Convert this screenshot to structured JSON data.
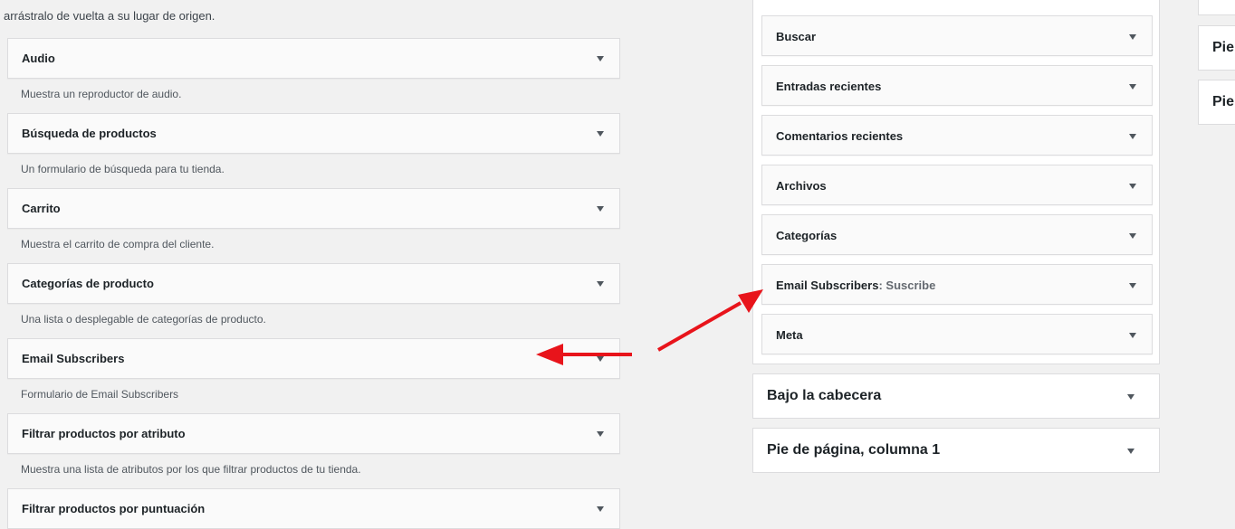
{
  "intro_text": "arrástralo de vuelta a su lugar de origen.",
  "available_widgets": [
    {
      "title": "Audio",
      "description": "Muestra un reproductor de audio."
    },
    {
      "title": "Búsqueda de productos",
      "description": "Un formulario de búsqueda para tu tienda."
    },
    {
      "title": "Carrito",
      "description": "Muestra el carrito de compra del cliente."
    },
    {
      "title": "Categorías de producto",
      "description": "Una lista o desplegable de categorías de producto."
    },
    {
      "title": "Email Subscribers",
      "description": "Formulario de Email Subscribers"
    },
    {
      "title": "Filtrar productos por atributo",
      "description": "Muestra una lista de atributos por los que filtrar productos de tu tienda."
    },
    {
      "title": "Filtrar productos por puntuación",
      "description": ""
    }
  ],
  "sidebar_widgets": [
    {
      "title": "Buscar",
      "subtitle": ""
    },
    {
      "title": "Entradas recientes",
      "subtitle": ""
    },
    {
      "title": "Comentarios recientes",
      "subtitle": ""
    },
    {
      "title": "Archivos",
      "subtitle": ""
    },
    {
      "title": "Categorías",
      "subtitle": ""
    },
    {
      "title": "Email Subscribers",
      "subtitle": ": Suscribe"
    },
    {
      "title": "Meta",
      "subtitle": ""
    }
  ],
  "widget_areas": [
    {
      "title": "Bajo la cabecera"
    },
    {
      "title": "Pie de página, columna 1"
    }
  ],
  "right_areas": [
    {
      "title": "Pie"
    },
    {
      "title": "Pie"
    }
  ],
  "colors": {
    "annotation_arrow": "#e8141b"
  }
}
